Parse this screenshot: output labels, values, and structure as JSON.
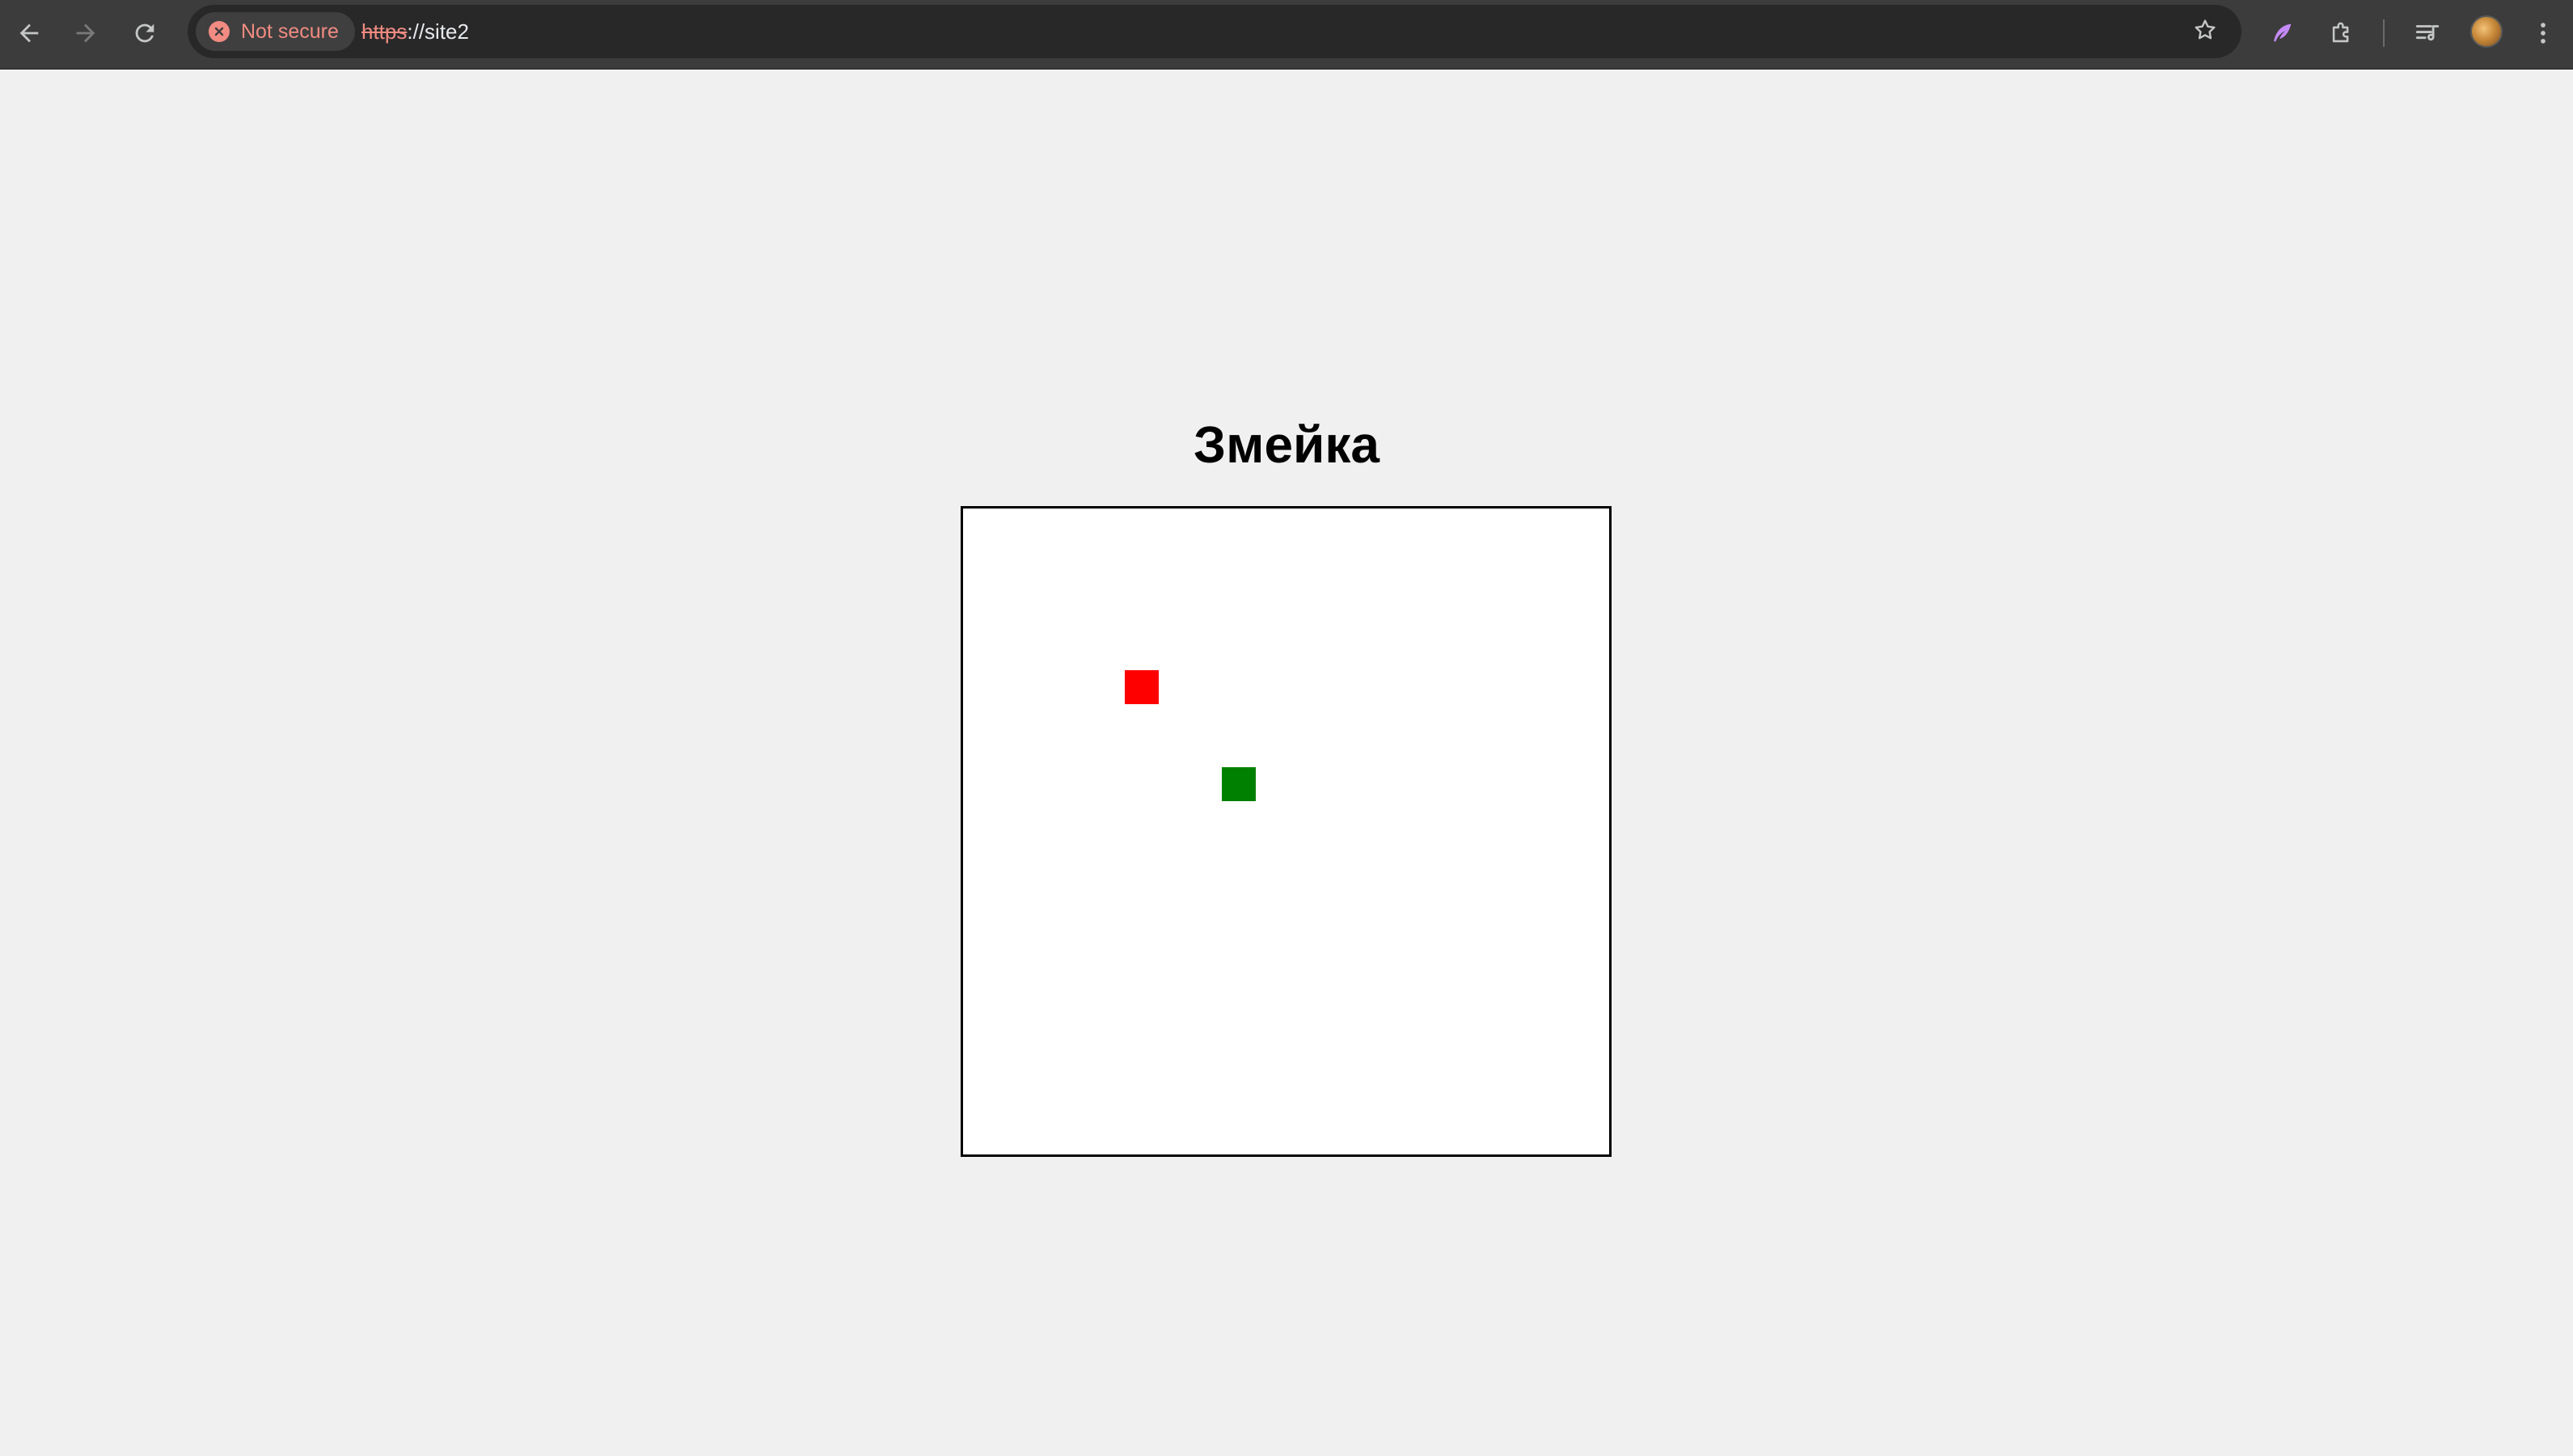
{
  "browser": {
    "security_label": "Not secure",
    "url_scheme": "https",
    "url_rest": "://site2",
    "icons": {
      "back": "arrow-left-icon",
      "forward": "arrow-right-icon",
      "reload": "reload-icon",
      "bookmark": "star-icon",
      "companion": "feather-icon",
      "extensions": "puzzle-icon",
      "media": "media-queue-icon",
      "menu": "kebab-menu-icon"
    },
    "colors": {
      "security_warning": "#f28b82"
    }
  },
  "page": {
    "title": "Змейка",
    "background": "#f0f0f0"
  },
  "game": {
    "board_color": "#ffffff",
    "food": {
      "color": "#ff0000",
      "cell": [
        5,
        5
      ]
    },
    "snake": [
      {
        "color": "#008000",
        "cell": [
          8,
          8
        ]
      }
    ]
  }
}
